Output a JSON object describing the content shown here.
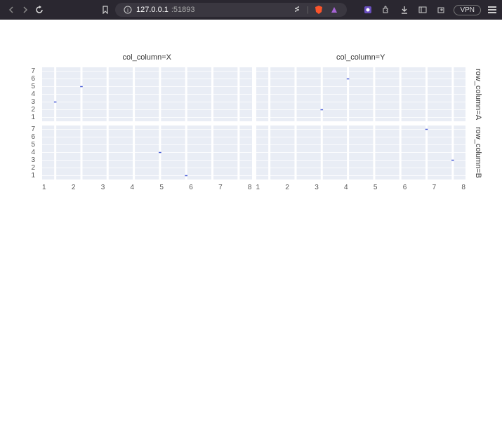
{
  "browser": {
    "url_host": "127.0.0.1",
    "url_port": ":51893",
    "vpn_label": "VPN",
    "icons": {
      "back": "back-icon",
      "forward": "forward-icon",
      "reload": "reload-icon",
      "bookmark": "bookmark-icon",
      "info": "info-icon",
      "share": "share-icon",
      "shield": "brave-shield-icon",
      "wallet": "wallet-icon",
      "ext1": "extension-icon",
      "puzzle": "extensions-puzzle-icon",
      "download": "download-icon",
      "sidepanel": "sidepanel-icon",
      "newtab": "newtab-icon",
      "menu": "menu-icon"
    }
  },
  "chart_data": [
    {
      "type": "scatter",
      "facet_col": "X",
      "facet_row": "A",
      "col_title": "col_column=X",
      "row_title": "row_column=A",
      "xlabel": "",
      "ylabel": "",
      "xlim": [
        0.5,
        8.5
      ],
      "ylim": [
        0.5,
        7.5
      ],
      "xticks": [
        1,
        2,
        3,
        4,
        5,
        6,
        7,
        8
      ],
      "yticks": [
        1,
        2,
        3,
        4,
        5,
        6,
        7
      ],
      "points": [
        {
          "x": 1,
          "y": 3
        },
        {
          "x": 2,
          "y": 5
        }
      ]
    },
    {
      "type": "scatter",
      "facet_col": "Y",
      "facet_row": "A",
      "col_title": "col_column=Y",
      "row_title": "row_column=A",
      "xlabel": "",
      "ylabel": "",
      "xlim": [
        0.5,
        8.5
      ],
      "ylim": [
        0.5,
        7.5
      ],
      "xticks": [
        1,
        2,
        3,
        4,
        5,
        6,
        7,
        8
      ],
      "yticks": [
        1,
        2,
        3,
        4,
        5,
        6,
        7
      ],
      "points": [
        {
          "x": 3,
          "y": 2
        },
        {
          "x": 4,
          "y": 6
        }
      ]
    },
    {
      "type": "scatter",
      "facet_col": "X",
      "facet_row": "B",
      "col_title": "col_column=X",
      "row_title": "row_column=B",
      "xlabel": "",
      "ylabel": "",
      "xlim": [
        0.5,
        8.5
      ],
      "ylim": [
        0.5,
        7.5
      ],
      "xticks": [
        1,
        2,
        3,
        4,
        5,
        6,
        7,
        8
      ],
      "yticks": [
        1,
        2,
        3,
        4,
        5,
        6,
        7
      ],
      "points": [
        {
          "x": 5,
          "y": 4
        },
        {
          "x": 6,
          "y": 1
        }
      ]
    },
    {
      "type": "scatter",
      "facet_col": "Y",
      "facet_row": "B",
      "col_title": "col_column=Y",
      "row_title": "row_column=B",
      "xlabel": "",
      "ylabel": "",
      "xlim": [
        0.5,
        8.5
      ],
      "ylim": [
        0.5,
        7.5
      ],
      "xticks": [
        1,
        2,
        3,
        4,
        5,
        6,
        7,
        8
      ],
      "yticks": [
        1,
        2,
        3,
        4,
        5,
        6,
        7
      ],
      "points": [
        {
          "x": 7,
          "y": 7
        },
        {
          "x": 8,
          "y": 3
        }
      ]
    }
  ]
}
